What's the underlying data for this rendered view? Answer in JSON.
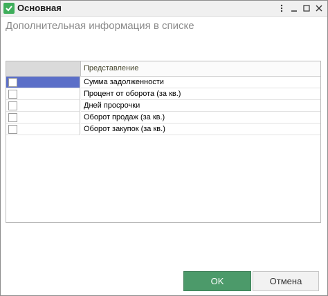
{
  "window": {
    "title": "Основная"
  },
  "form": {
    "title": "Дополнительная информация в списке"
  },
  "list": {
    "columns": {
      "check": "",
      "representation": "Представление"
    },
    "selected_index": 0,
    "rows": [
      {
        "checked": false,
        "label": "Сумма задолженности"
      },
      {
        "checked": false,
        "label": "Процент от оборота (за кв.)"
      },
      {
        "checked": false,
        "label": "Дней просрочки"
      },
      {
        "checked": false,
        "label": "Оборот продаж (за кв.)"
      },
      {
        "checked": false,
        "label": "Оборот закупок (за кв.)"
      }
    ]
  },
  "buttons": {
    "ok": "OK",
    "cancel": "Отмена"
  },
  "colors": {
    "accent_ok": "#4c9a6a",
    "selection": "#5b6fc8",
    "app_icon": "#3fae5b"
  },
  "icons": {
    "app": "checkmark-icon",
    "menu": "more-options-icon",
    "minimize": "minimize-icon",
    "maximize": "maximize-icon",
    "close": "close-icon"
  }
}
